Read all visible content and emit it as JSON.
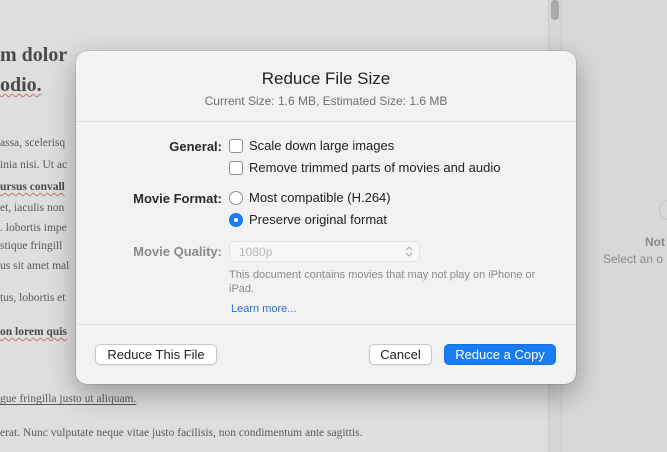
{
  "document": {
    "heading_1": "m dolor",
    "heading_2": "odio.",
    "lines": [
      "assa, scelerisq",
      "inia nisi. Ut ac",
      "ursus convall",
      "et, iaculis non",
      ". lobortis impe",
      "stique fringill",
      "us sit amet mal",
      "tus, lobortis et",
      "on lorem quis",
      "gue fringilla justo ut aliquam.",
      "erat. Nunc vulputate neque vitae justo facilisis, non condimentum ante sagittis."
    ]
  },
  "inspector": {
    "title": "Not",
    "subtitle": "Select an o"
  },
  "dialog": {
    "title": "Reduce File Size",
    "subtitle": "Current Size: 1.6 MB, Estimated Size: 1.6 MB",
    "general_label": "General:",
    "general_options": [
      {
        "label": "Scale down large images",
        "checked": false
      },
      {
        "label": "Remove trimmed parts of movies and audio",
        "checked": false
      }
    ],
    "format_label": "Movie Format:",
    "format_options": [
      {
        "label": "Most compatible (H.264)",
        "selected": false
      },
      {
        "label": "Preserve original format",
        "selected": true
      }
    ],
    "quality_label": "Movie Quality:",
    "quality_value": "1080p",
    "note": "This document contains movies that may not play on iPhone or iPad.",
    "learn_more": "Learn more...",
    "buttons": {
      "reduce_this_file": "Reduce This File",
      "cancel": "Cancel",
      "reduce_a_copy": "Reduce a Copy"
    },
    "accent_color": "#1a7cf2"
  }
}
